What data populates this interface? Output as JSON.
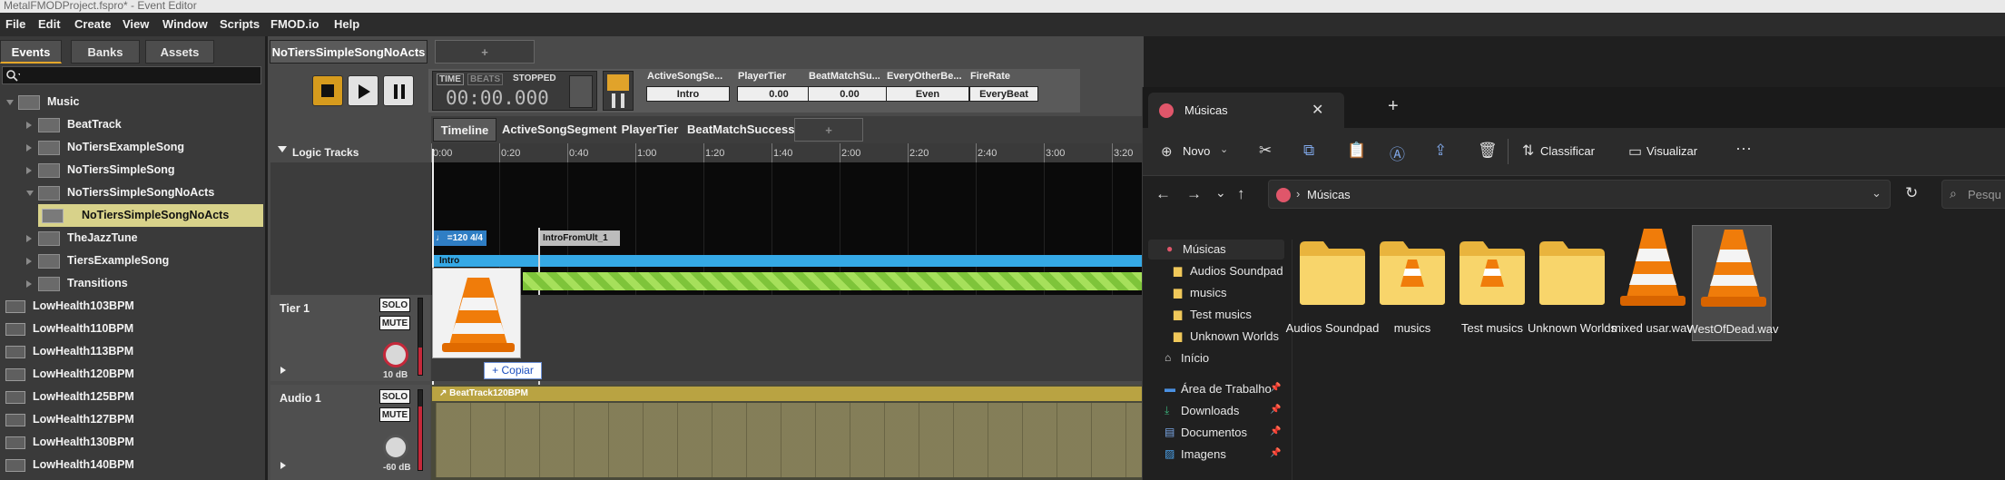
{
  "window_title": "MetalFMODProject.fspro* - Event Editor",
  "menu": [
    "File",
    "Edit",
    "Create",
    "View",
    "Window",
    "Scripts",
    "FMOD.io",
    "Help"
  ],
  "left_tabs": [
    "Events",
    "Banks",
    "Assets"
  ],
  "tree": [
    {
      "label": "Music",
      "type": "folder",
      "indent": 0,
      "open": true
    },
    {
      "label": "BeatTrack",
      "type": "folder",
      "indent": 1,
      "open": false
    },
    {
      "label": "NoTiersExampleSong",
      "type": "folder",
      "indent": 1,
      "open": false
    },
    {
      "label": "NoTiersSimpleSong",
      "type": "folder",
      "indent": 1,
      "open": false
    },
    {
      "label": "NoTiersSimpleSongNoActs",
      "type": "folder",
      "indent": 1,
      "open": true
    },
    {
      "label": "NoTiersSimpleSongNoActs",
      "type": "event",
      "indent": 2,
      "selected": true
    },
    {
      "label": "TheJazzTune",
      "type": "folder",
      "indent": 1,
      "open": false
    },
    {
      "label": "TiersExampleSong",
      "type": "folder",
      "indent": 1,
      "open": false
    },
    {
      "label": "Transitions",
      "type": "folder",
      "indent": 1,
      "open": false
    },
    {
      "label": "LowHealth103BPM",
      "type": "event",
      "indent": 0
    },
    {
      "label": "LowHealth110BPM",
      "type": "event",
      "indent": 0
    },
    {
      "label": "LowHealth113BPM",
      "type": "event",
      "indent": 0
    },
    {
      "label": "LowHealth120BPM",
      "type": "event",
      "indent": 0
    },
    {
      "label": "LowHealth125BPM",
      "type": "event",
      "indent": 0
    },
    {
      "label": "LowHealth127BPM",
      "type": "event",
      "indent": 0
    },
    {
      "label": "LowHealth130BPM",
      "type": "event",
      "indent": 0
    },
    {
      "label": "LowHealth140BPM",
      "type": "event",
      "indent": 0
    }
  ],
  "editor_tab": "NoTiersSimpleSongNoActs",
  "add_tab": "+",
  "transport": {
    "time_label": "TIME",
    "beats_label": "BEATS",
    "state": "STOPPED",
    "time": "00:00.000"
  },
  "params": [
    {
      "name": "ActiveSongSe...",
      "value": "Intro"
    },
    {
      "name": "PlayerTier",
      "value": "0.00"
    },
    {
      "name": "BeatMatchSu...",
      "value": "0.00"
    },
    {
      "name": "EveryOtherBe...",
      "value": "Even"
    },
    {
      "name": "FireRate",
      "value": "EveryBeat"
    }
  ],
  "subtabs": [
    "Timeline",
    "ActiveSongSegment",
    "PlayerTier",
    "BeatMatchSuccess",
    "+"
  ],
  "ruler": [
    "0:00",
    "0:20",
    "0:40",
    "1:00",
    "1:20",
    "1:40",
    "2:00",
    "2:20",
    "2:40",
    "3:00",
    "3:20"
  ],
  "logic_tracks": "Logic Tracks",
  "tempo": "=120 4/4",
  "marker": "IntroFromUlt_1",
  "region": "Intro",
  "tracks": [
    {
      "name": "Tier 1",
      "solo": "SOLO",
      "mute": "MUTE",
      "db": "10 dB"
    },
    {
      "name": "Audio 1",
      "solo": "SOLO",
      "mute": "MUTE",
      "db": "-60 dB"
    }
  ],
  "copy_tooltip": "+ Copiar",
  "beat_track": "BeatTrack120BPM",
  "explorer": {
    "tab_title": "Músicas",
    "new_label": "Novo",
    "sort_label": "Classificar",
    "view_label": "Visualizar",
    "path": "Músicas",
    "search_placeholder": "Pesqu",
    "nav": [
      {
        "label": "Músicas",
        "icon": "music-icon",
        "pin": false
      },
      {
        "label": "Audios Soundpad",
        "icon": "folder-icon",
        "pin": false
      },
      {
        "label": "musics",
        "icon": "folder-icon",
        "pin": false
      },
      {
        "label": "Test musics",
        "icon": "folder-icon",
        "pin": false
      },
      {
        "label": "Unknown Worlds",
        "icon": "folder-icon",
        "pin": false
      },
      {
        "label": "Início",
        "icon": "home-icon",
        "pin": false
      },
      {
        "label": "Área de Trabalho",
        "icon": "desktop-icon",
        "pin": true
      },
      {
        "label": "Downloads",
        "icon": "download-icon",
        "pin": true
      },
      {
        "label": "Documentos",
        "icon": "document-icon",
        "pin": true
      },
      {
        "label": "Imagens",
        "icon": "image-icon",
        "pin": true
      }
    ],
    "files": [
      {
        "label": "Audios Soundpad",
        "kind": "folder"
      },
      {
        "label": "musics",
        "kind": "vlc-folder"
      },
      {
        "label": "Test musics",
        "kind": "vlc-folder"
      },
      {
        "label": "Unknown Worlds",
        "kind": "folder"
      },
      {
        "label": "mixed usar.wav",
        "kind": "vlc"
      },
      {
        "label": "WestOfDead.wav",
        "kind": "vlc",
        "selected": true
      }
    ]
  },
  "colors": {
    "accent": "#e4a72a",
    "selected_row": "#d8d28a",
    "intro": "#35a9e6",
    "green": "#7ec43a",
    "beat": "#b9a342"
  }
}
